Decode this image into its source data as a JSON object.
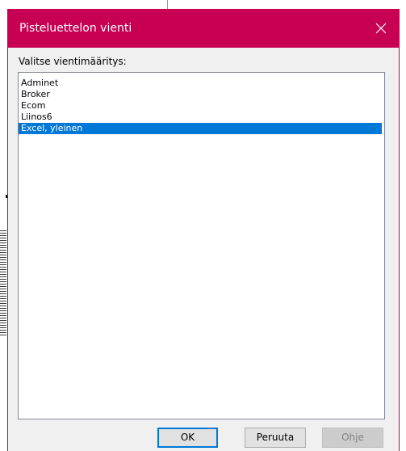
{
  "dialog": {
    "title": "Pisteluettelon vienti",
    "close_icon": "close-icon",
    "accent_color": "#c80054"
  },
  "export_list": {
    "label": "Valitse vientimääritys:",
    "items": [
      {
        "label": "Adminet",
        "selected": false
      },
      {
        "label": "Broker",
        "selected": false
      },
      {
        "label": "Ecom",
        "selected": false
      },
      {
        "label": "Liinos6",
        "selected": false
      },
      {
        "label": "Excel, yleinen",
        "selected": true
      }
    ],
    "selection_color": "#0078d7"
  },
  "buttons": {
    "ok_label": "OK",
    "cancel_label": "Peruuta",
    "help_label": "Ohje"
  }
}
